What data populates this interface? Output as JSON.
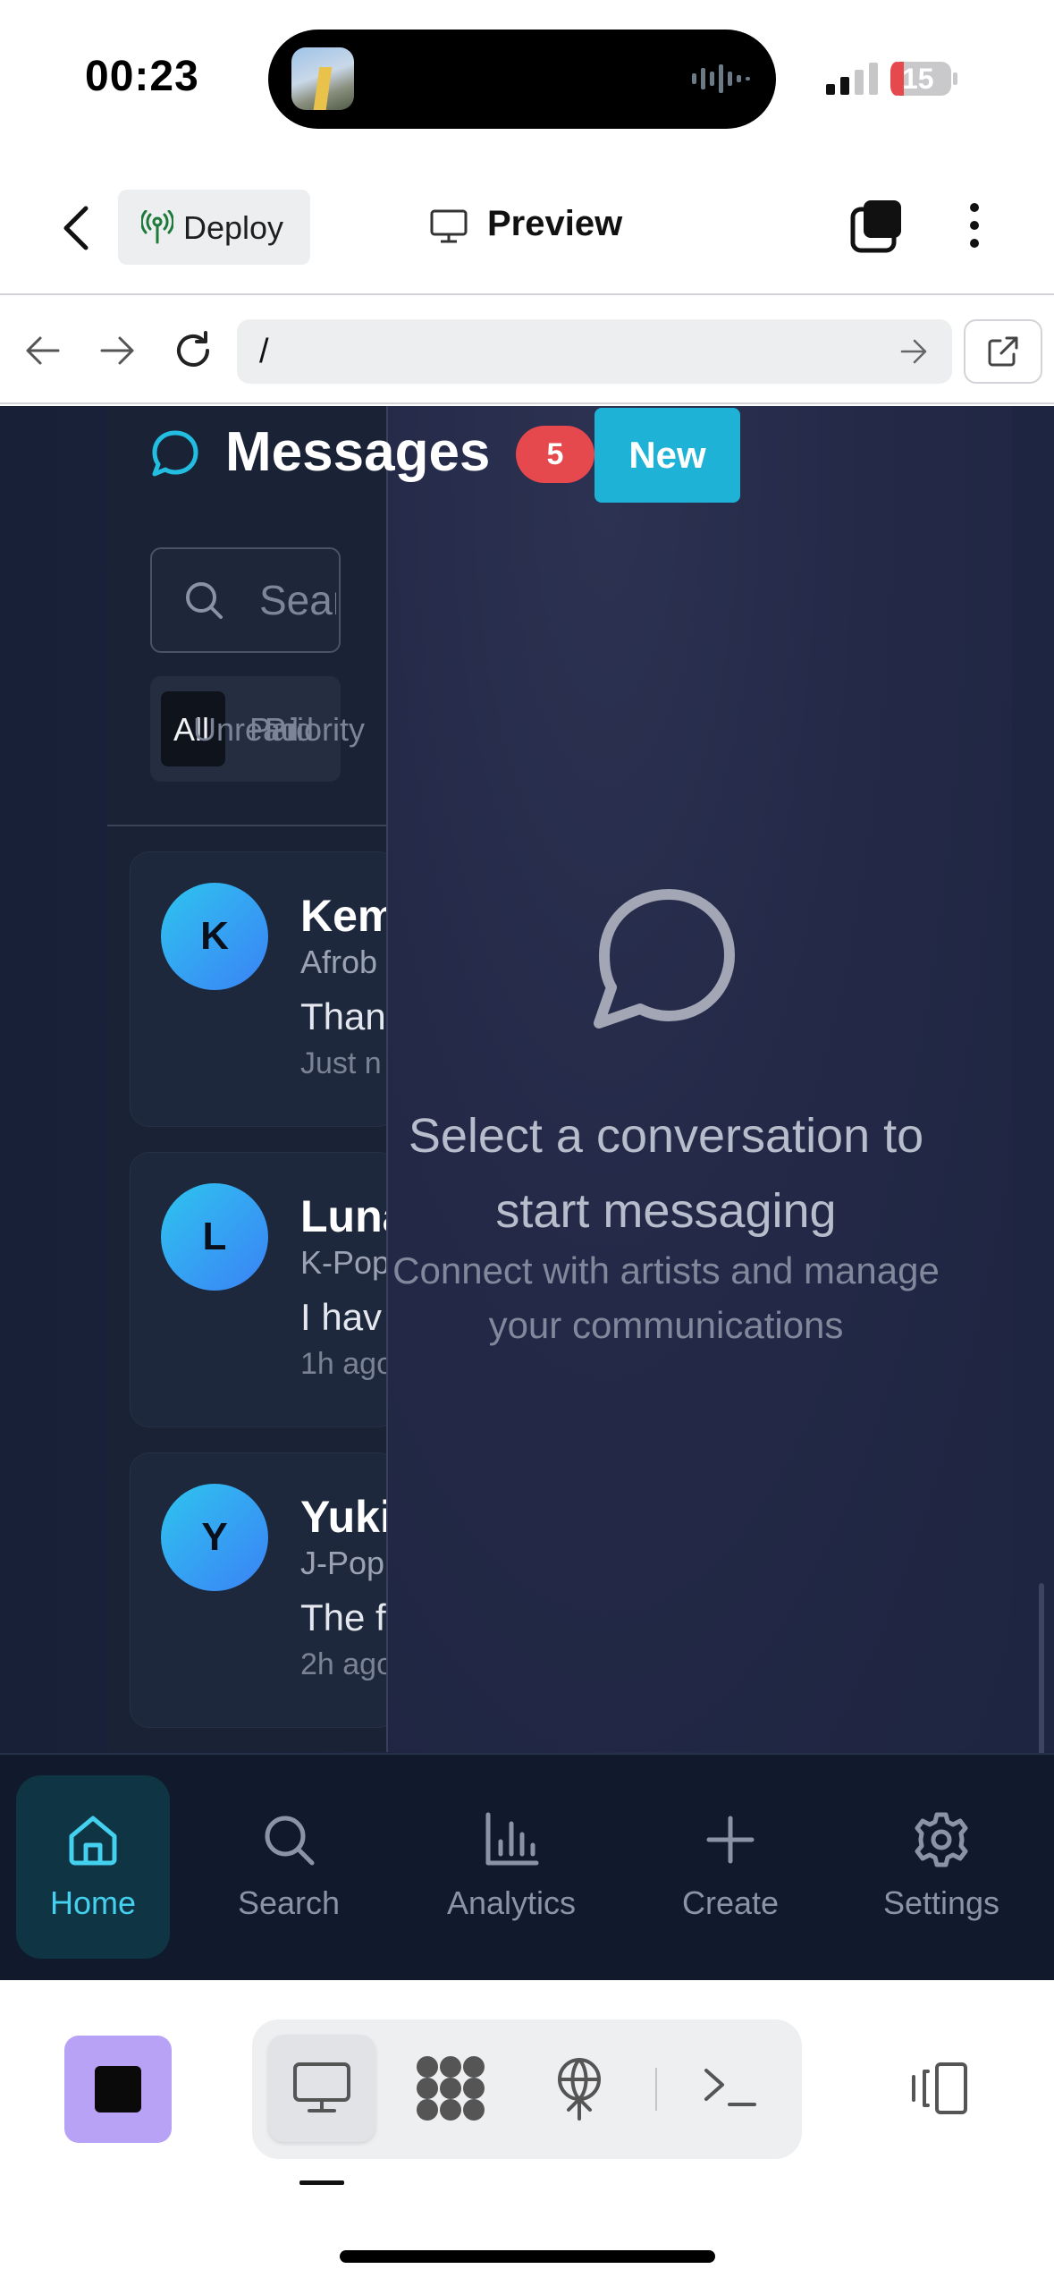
{
  "status_bar": {
    "time": "00:23",
    "battery": "15"
  },
  "top_bar": {
    "deploy_label": "Deploy",
    "preview_label": "Preview"
  },
  "url_bar": {
    "url": "/"
  },
  "messages": {
    "title": "Messages",
    "unread_count": "5",
    "new_label": "New",
    "search_placeholder": "Search",
    "filters": [
      "All",
      "Unread",
      "Paid",
      "Priority"
    ],
    "conversations": [
      {
        "initial": "K",
        "name": "Kem",
        "genre": "Afrob",
        "preview": "Than",
        "time": "Just n"
      },
      {
        "initial": "L",
        "name": "Luna",
        "genre": "K-Pop",
        "preview": "I hav",
        "time": "1h ago"
      },
      {
        "initial": "Y",
        "name": "Yuki",
        "genre": "J-Pop",
        "preview": "The f",
        "time": "2h ago"
      }
    ]
  },
  "empty_state": {
    "title": "Select a conversation to start messaging",
    "subtitle": "Connect with artists and manage your communications"
  },
  "tabs": [
    {
      "label": "Home",
      "icon": "home-icon",
      "active": true
    },
    {
      "label": "Search",
      "icon": "search-icon",
      "active": false
    },
    {
      "label": "Analytics",
      "icon": "analytics-icon",
      "active": false
    },
    {
      "label": "Create",
      "icon": "plus-icon",
      "active": false
    },
    {
      "label": "Settings",
      "icon": "gear-icon",
      "active": false
    }
  ],
  "colors": {
    "accent": "#1eb3d6",
    "badge": "#e5484d",
    "tab_active": "#44d0ef",
    "stop_button": "#b7a2f5"
  }
}
